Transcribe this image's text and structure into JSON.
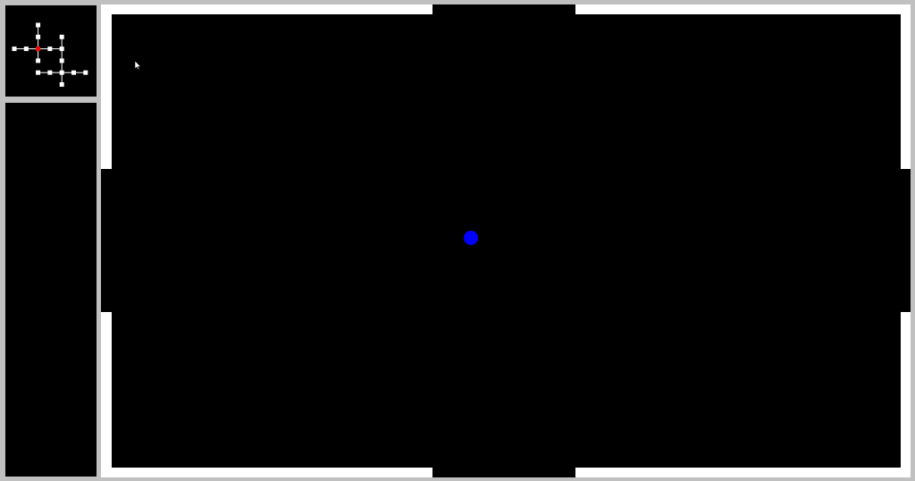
{
  "colors": {
    "background": "#c0c0c0",
    "wall": "#ffffff",
    "floor": "#000000",
    "player": "#0000ff",
    "minimap_room": "#ffffff",
    "minimap_current_room": "#ff0000"
  },
  "minimap": {
    "rooms": [
      {
        "col": 2,
        "row": 0,
        "current": false
      },
      {
        "col": 0,
        "row": 2,
        "current": false
      },
      {
        "col": 1,
        "row": 2,
        "current": false
      },
      {
        "col": 2,
        "row": 2,
        "current": true
      },
      {
        "col": 3,
        "row": 2,
        "current": false
      },
      {
        "col": 4,
        "row": 2,
        "current": false
      },
      {
        "col": 2,
        "row": 1,
        "current": false
      },
      {
        "col": 4,
        "row": 1,
        "current": false
      },
      {
        "col": 2,
        "row": 3,
        "current": false
      },
      {
        "col": 4,
        "row": 3,
        "current": false
      },
      {
        "col": 4,
        "row": 4,
        "current": false
      },
      {
        "col": 5,
        "row": 4,
        "current": false
      },
      {
        "col": 4,
        "row": 5,
        "current": false
      },
      {
        "col": 6,
        "row": 4,
        "current": false
      },
      {
        "col": 3,
        "row": 4,
        "current": false
      },
      {
        "col": 2,
        "row": 4,
        "current": false
      }
    ],
    "connections": [
      [
        [
          2,
          0
        ],
        [
          2,
          1
        ]
      ],
      [
        [
          2,
          1
        ],
        [
          2,
          2
        ]
      ],
      [
        [
          0,
          2
        ],
        [
          1,
          2
        ]
      ],
      [
        [
          1,
          2
        ],
        [
          2,
          2
        ]
      ],
      [
        [
          2,
          2
        ],
        [
          3,
          2
        ]
      ],
      [
        [
          3,
          2
        ],
        [
          4,
          2
        ]
      ],
      [
        [
          4,
          1
        ],
        [
          4,
          2
        ]
      ],
      [
        [
          2,
          2
        ],
        [
          2,
          3
        ]
      ],
      [
        [
          4,
          2
        ],
        [
          4,
          3
        ]
      ],
      [
        [
          4,
          3
        ],
        [
          4,
          4
        ]
      ],
      [
        [
          4,
          4
        ],
        [
          5,
          4
        ]
      ],
      [
        [
          5,
          4
        ],
        [
          6,
          4
        ]
      ],
      [
        [
          4,
          4
        ],
        [
          4,
          5
        ]
      ],
      [
        [
          3,
          4
        ],
        [
          4,
          4
        ]
      ],
      [
        [
          2,
          4
        ],
        [
          3,
          4
        ]
      ]
    ]
  },
  "room": {
    "doors": [
      "top",
      "bottom",
      "left",
      "right"
    ]
  },
  "icons": {
    "player": "player-dot-icon",
    "cursor": "mouse-cursor-icon"
  }
}
